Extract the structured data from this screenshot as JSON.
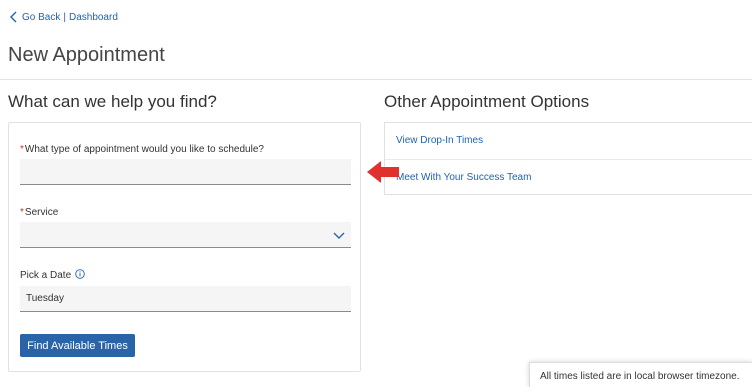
{
  "nav": {
    "back_label": "Go Back",
    "separator": "|",
    "dashboard_label": "Dashboard"
  },
  "page": {
    "title": "New Appointment"
  },
  "form": {
    "heading": "What can we help you find?",
    "appointment_type_label": "What type of appointment would you like to schedule?",
    "appointment_type_value": "",
    "service_label": "Service",
    "service_value": "",
    "date_label": "Pick a Date",
    "date_value": "Tuesday",
    "find_button_label": "Find Available Times",
    "required_marker": "*"
  },
  "options": {
    "heading": "Other Appointment Options",
    "items": [
      {
        "label": "View Drop-In Times"
      },
      {
        "label": "Meet With Your Success Team"
      }
    ]
  },
  "toast": {
    "text": "All times listed are in local browser timezone."
  },
  "colors": {
    "link": "#1f62b0",
    "primary_button": "#2a64a8",
    "required": "#c0392b",
    "annotation_arrow": "#e0312f"
  },
  "icons": {
    "back": "chevron-left-icon",
    "dropdown": "chevron-down-icon",
    "info": "info-icon",
    "annotation": "arrow-left-icon"
  }
}
